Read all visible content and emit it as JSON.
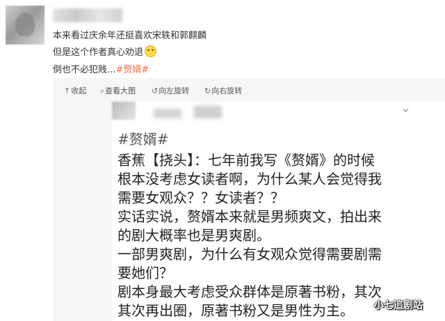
{
  "post": {
    "line1": "本来看过庆余年还挺喜欢宋轶和郭麒麟",
    "line2": "但是这个作者真心劝退",
    "line3_text": "倒也不必犯贱...",
    "line3_tag": "#赘婿#"
  },
  "toolbar": {
    "collapse": "收起",
    "view_large": "查看大图",
    "rotate_left": "向左旋转",
    "rotate_right": "向右旋转"
  },
  "card": {
    "hashtag": "#赘婿#",
    "lines": [
      "香蕉【挠头】：七年前我写《赘婿》的时候",
      "根本没考虑女读者啊，为什么某人会觉得我",
      "需要女观众？？女读者？？",
      "实话实说，赘婿本来就是男频爽文，拍出来",
      "的剧大概率也是男爽剧。",
      "一部男爽剧，为什么有女观众觉得需要剧需",
      "要她们？",
      "剧本身最大考虑受众群体是原著书粉，其次",
      "其次再出圈，原著书粉又是男性为主。"
    ]
  },
  "watermark": "小七追剧站"
}
